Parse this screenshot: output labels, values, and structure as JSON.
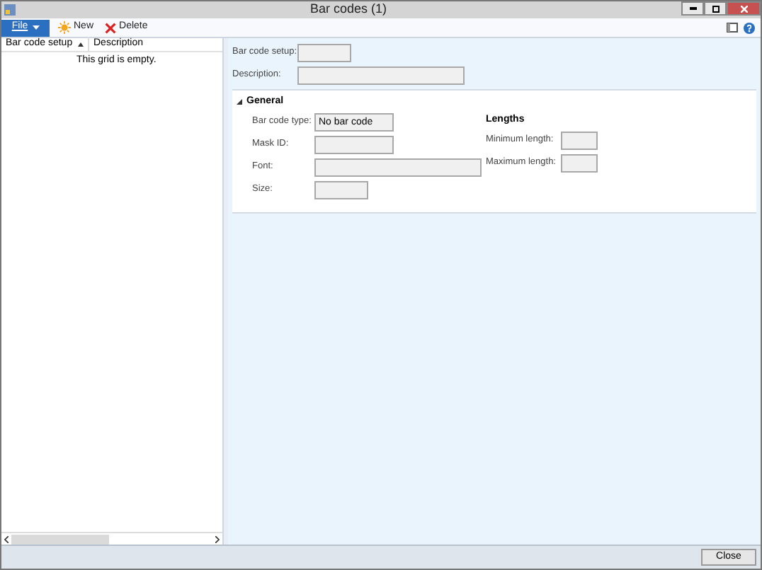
{
  "window": {
    "title": "Bar codes (1)"
  },
  "file_menu": {
    "label": "File"
  },
  "toolbar": [
    {
      "label": "New",
      "kind": "new"
    },
    {
      "label": "Delete",
      "kind": "delete"
    }
  ],
  "grid": {
    "columns": [
      {
        "label": "Bar code setup",
        "sorted": true
      },
      {
        "label": "Description",
        "sorted": false
      }
    ],
    "empty_message": "This grid is empty."
  },
  "header_fields": [
    {
      "label": "Bar code setup:",
      "kind": "short"
    },
    {
      "label": "Description:",
      "kind": "long"
    }
  ],
  "section": {
    "title": "General",
    "expanded": true,
    "fields": [
      {
        "label": "Bar code type:",
        "value": "No bar code",
        "kind": "medium"
      },
      {
        "label": "Mask ID:",
        "kind": "medium"
      },
      {
        "label": "Font:",
        "kind": "long"
      },
      {
        "label": "Size:",
        "kind": "short"
      }
    ],
    "group": {
      "title": "Lengths",
      "fields": [
        {
          "label": "Minimum length:",
          "kind": "tiny"
        },
        {
          "label": "Maximum length:",
          "kind": "tiny"
        }
      ]
    }
  },
  "footer": {
    "close_button": "Close"
  }
}
